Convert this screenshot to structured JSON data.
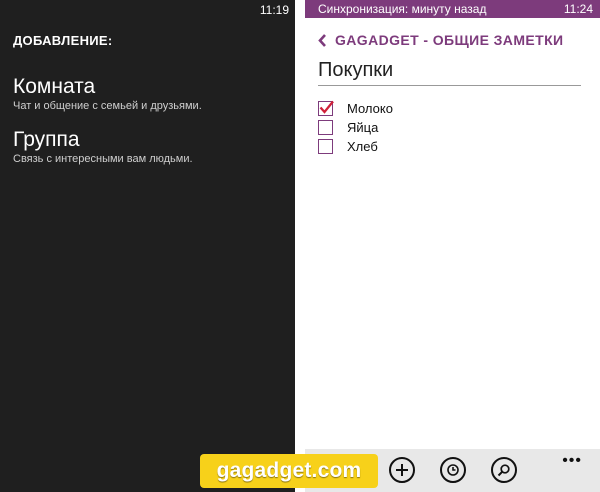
{
  "left": {
    "time": "11:19",
    "header": "ДОБАВЛЕНИЕ:",
    "items": [
      {
        "title": "Комната",
        "subtitle": "Чат и общение с семьей и друзьями."
      },
      {
        "title": "Группа",
        "subtitle": "Связь с интересными вам людьми."
      }
    ]
  },
  "right": {
    "status": {
      "text": "Синхронизация: минуту назад",
      "time": "11:24"
    },
    "nav_title": "GAGADGET - ОБЩИЕ ЗАМЕТКИ",
    "note_title": "Покупки",
    "items": [
      {
        "label": "Молоко",
        "checked": true
      },
      {
        "label": "Яйца",
        "checked": false
      },
      {
        "label": "Хлеб",
        "checked": false
      }
    ],
    "appbar": {
      "icons": [
        "add-icon",
        "history-icon",
        "search-icon"
      ],
      "more": "•••"
    }
  },
  "watermark": "gagadget.com",
  "colors": {
    "accent": "#7d3b7c",
    "left_bg": "#1f1f1f",
    "watermark_bg": "#f7d11a",
    "check": "#d0213a"
  }
}
